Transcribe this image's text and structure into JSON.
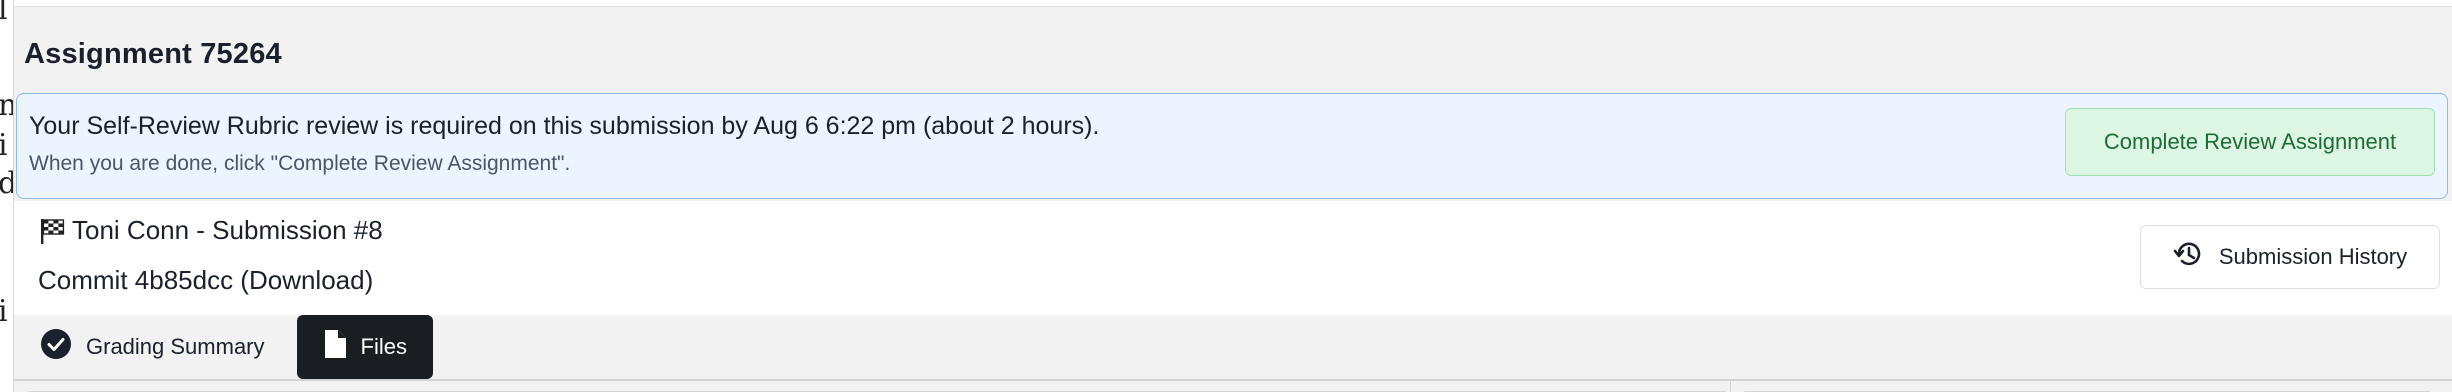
{
  "left_edge_glyphs": [
    "l",
    "n",
    "i",
    "d",
    "i"
  ],
  "card": {
    "title": "Assignment 75264"
  },
  "alert": {
    "message": "Your Self-Review Rubric review is required on this submission by Aug 6 6:22 pm (about 2 hours).",
    "hint": "When you are done, click \"Complete Review Assignment\".",
    "action_label": "Complete Review Assignment"
  },
  "submission": {
    "flag_icon": "checkered-flag-icon",
    "title": "Toni Conn - Submission #8",
    "commit": "Commit 4b85dcc (Download)",
    "history_icon": "history-icon",
    "history_label": "Submission History"
  },
  "tabs": [
    {
      "label": "Grading Summary",
      "icon": "check-circle-icon",
      "active": false
    },
    {
      "label": "Files",
      "icon": "file-icon",
      "active": true
    }
  ],
  "colors": {
    "alert_bg": "#ebf4ff",
    "alert_border": "#90b8ec",
    "success_bg": "#dcf6e3",
    "success_text": "#1f6b37",
    "active_tab_bg": "#1a1d21"
  }
}
